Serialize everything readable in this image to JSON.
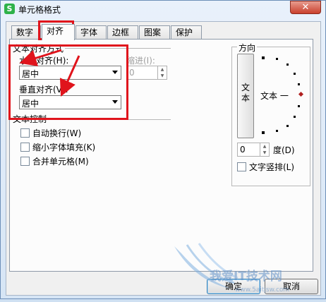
{
  "window": {
    "title": "单元格格式",
    "app_icon_glyph": "S",
    "close_glyph": "✕"
  },
  "tabs": [
    "数字",
    "对齐",
    "字体",
    "边框",
    "图案",
    "保护"
  ],
  "active_tab": "对齐",
  "alignment": {
    "section_title": "文本对齐方式",
    "horizontal_label": "水平对齐(H):",
    "horizontal_value": "居中",
    "indent_label": "缩进(I):",
    "indent_value": "0",
    "vertical_label": "垂直对齐(V):",
    "vertical_value": "居中"
  },
  "text_control": {
    "section_title": "文本控制",
    "options": [
      {
        "label": "自动换行(W)",
        "checked": false
      },
      {
        "label": "缩小字体填充(K)",
        "checked": false
      },
      {
        "label": "合并单元格(M)",
        "checked": false
      }
    ]
  },
  "orientation": {
    "title": "方向",
    "vertical_text": "文本",
    "dial_text": "文本 一",
    "degrees_value": "0",
    "degrees_label": "度(D)",
    "vertical_checkbox_label": "文字竖排(L)"
  },
  "buttons": {
    "ok": "确定",
    "cancel": "取消"
  },
  "annotation": {
    "color": "#e0141c"
  },
  "watermark": {
    "text": "我爱IT技术网",
    "url": "www.5aitjsw.com"
  }
}
